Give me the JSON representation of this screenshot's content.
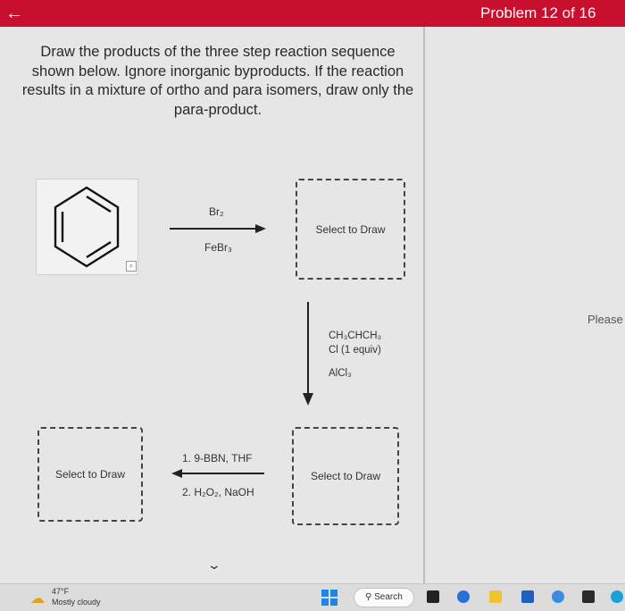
{
  "header": {
    "back_icon": "arrow-left-icon",
    "problem_counter": "Problem 12 of 16",
    "color": "#c8102e"
  },
  "instructions": "Draw the products of the three step reaction sequence shown below. Ignore inorganic byproducts. If the reaction results in a mixture of ortho and para isomers, draw only the para-product.",
  "right_panel_text": "Please",
  "reaction": {
    "step1": {
      "reagent_top": "Br₂",
      "reagent_bottom": "FeBr₃"
    },
    "step2": {
      "reagent_line1": "CH₃CHCH₃",
      "reagent_line2": "Cl (1 equiv)",
      "reagent_line3": "AlCl₃"
    },
    "step3": {
      "reagent_top": "1. 9-BBN, THF",
      "reagent_bottom": "2. H₂O₂, NaOH"
    },
    "draw_box_1": "Select to Draw",
    "draw_box_2": "Select to Draw",
    "draw_box_3": "Select to Draw"
  },
  "taskbar": {
    "weather_temp": "47°F",
    "weather_desc": "Mostly cloudy",
    "search_label": "Search"
  }
}
